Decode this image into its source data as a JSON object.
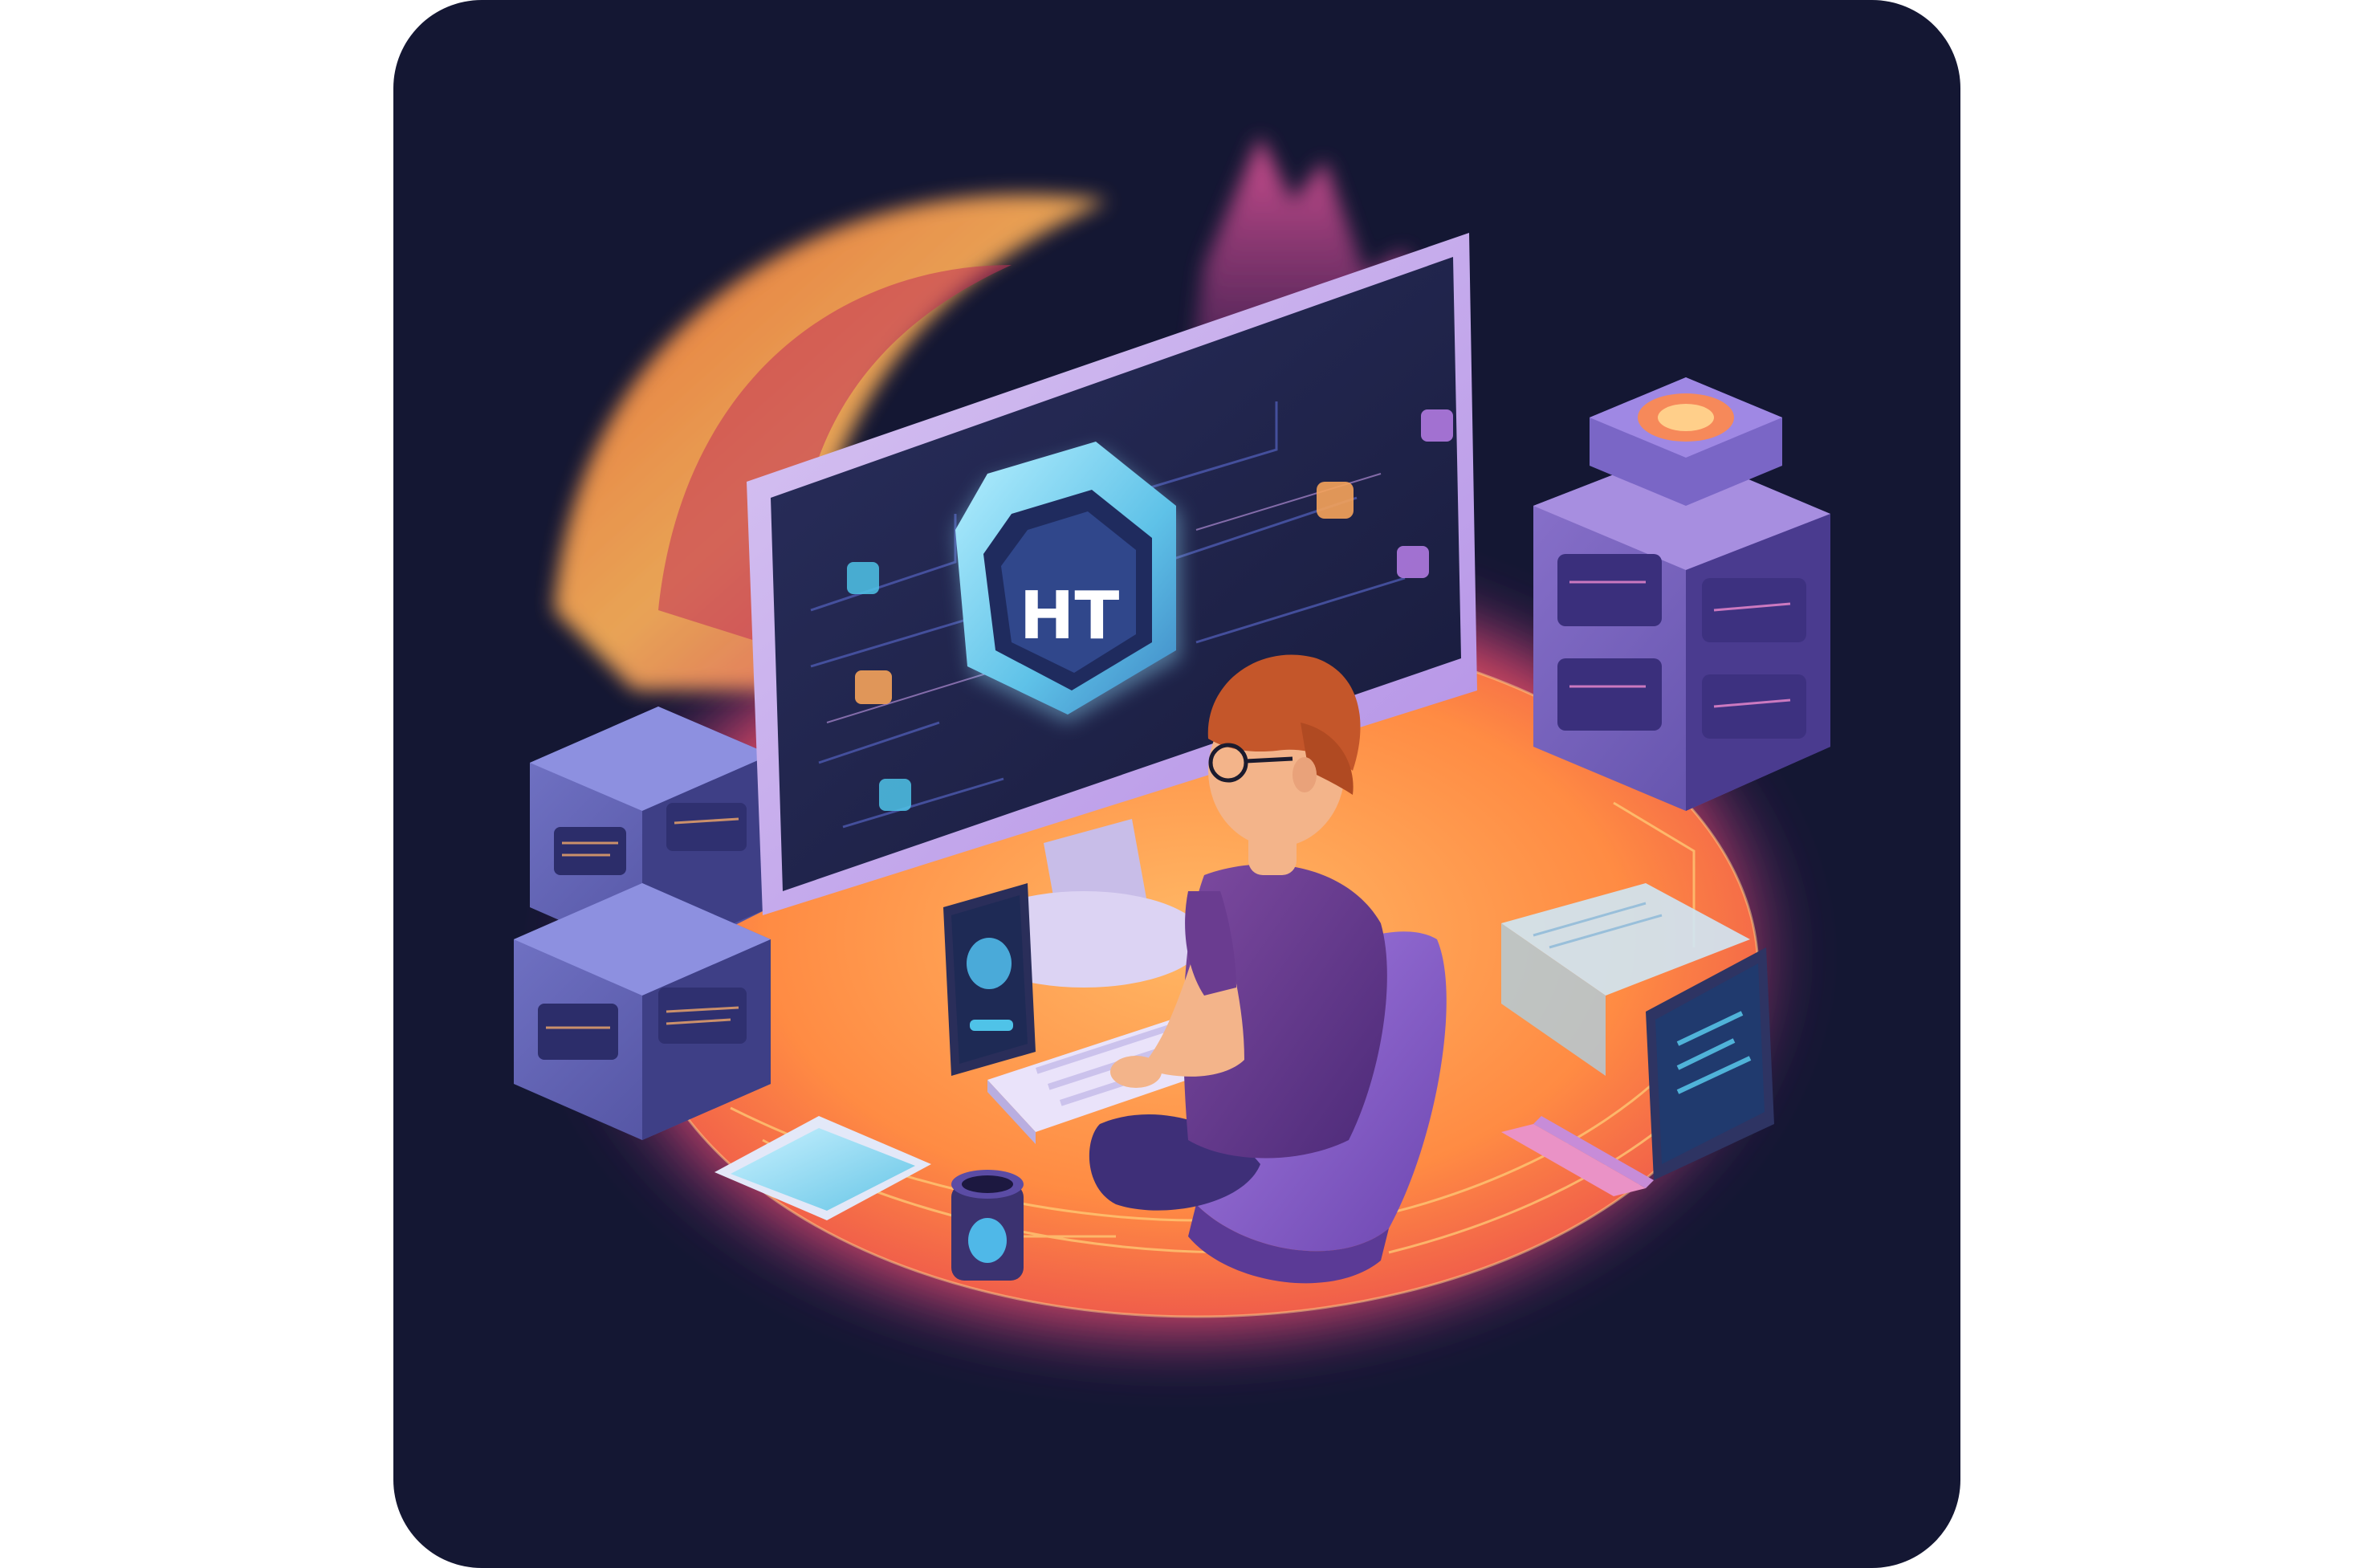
{
  "illustration": {
    "monitor_badge_text": "HT",
    "colors": {
      "background_card": "#141733",
      "platform_glow": "#ff8a3d",
      "platform_core": "#ffb15a",
      "arc_outer": "#ff6a3d",
      "screen": "#1e2245",
      "badge_fill": "#5fc2e8",
      "server_blocks": "#5a5ca8",
      "shirt": "#6c3e8e",
      "hair": "#c4562a",
      "chair": "#8a5fc7"
    },
    "icons": [
      "monitor-icon",
      "hexagon-badge-icon",
      "server-stack-icon",
      "cube-block-icon",
      "tablet-icon",
      "laptop-icon",
      "keyboard-icon",
      "mug-icon",
      "person-icon",
      "chair-icon"
    ]
  }
}
